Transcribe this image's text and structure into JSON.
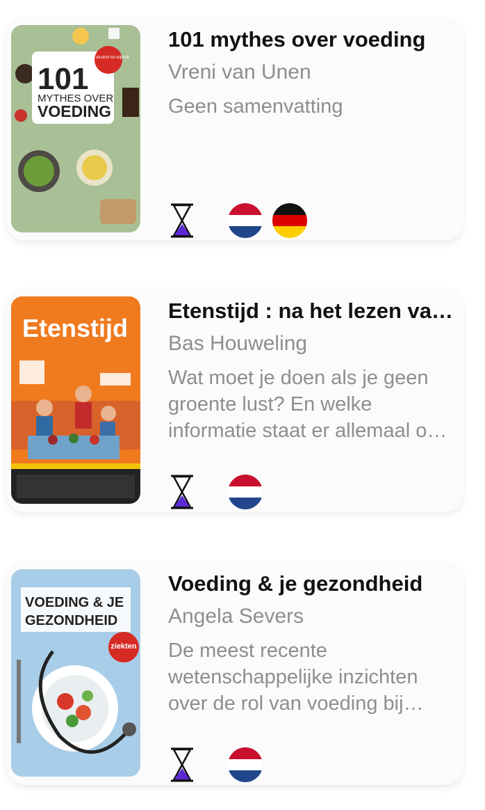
{
  "books": [
    {
      "title": "101 mythes over voeding",
      "author": "Vreni van Unen",
      "summary": "Geen samenvatting",
      "cover": {
        "heading_number": "101",
        "heading_line1": "MYTHES OVER",
        "heading_line2": "VOEDING",
        "sticker": "Van alcohol tot wijnruit",
        "colors": {
          "bg": "#9db58a",
          "panel": "#ffffff",
          "sticker": "#d62a24"
        }
      },
      "status_icon": "hourglass-icon",
      "languages": [
        "nl-flag",
        "de-flag"
      ]
    },
    {
      "title": "Etenstijd : na het lezen van dit boek weet je meer over voeding dan je ouders!",
      "author": "Bas Houweling",
      "summary": "Wat moet je doen als je geen groente lust? En welke informatie staat er allemaal op de verpakking?",
      "cover": {
        "heading": "Etenstijd",
        "colors": {
          "bg": "#f07a1e",
          "table": "#6fa2c9"
        }
      },
      "status_icon": "hourglass-icon",
      "languages": [
        "nl-flag"
      ]
    },
    {
      "title": "Voeding & je gezondheid",
      "author": "Angela Severs",
      "summary": "De meest recente wetenschappelijke inzichten over de rol van voeding bij ziekten en gezondheid.",
      "cover": {
        "heading_line1": "VOEDING & JE",
        "heading_line2": "GEZONDHEID",
        "sticker": "ziekten",
        "colors": {
          "bg": "#a8cde8",
          "sticker": "#d62a24"
        }
      },
      "status_icon": "hourglass-icon",
      "languages": [
        "nl-flag"
      ]
    }
  ],
  "colors": {
    "title": "#111111",
    "muted": "#8e8e8e",
    "hourglass_fill": "#5b2ad6"
  }
}
